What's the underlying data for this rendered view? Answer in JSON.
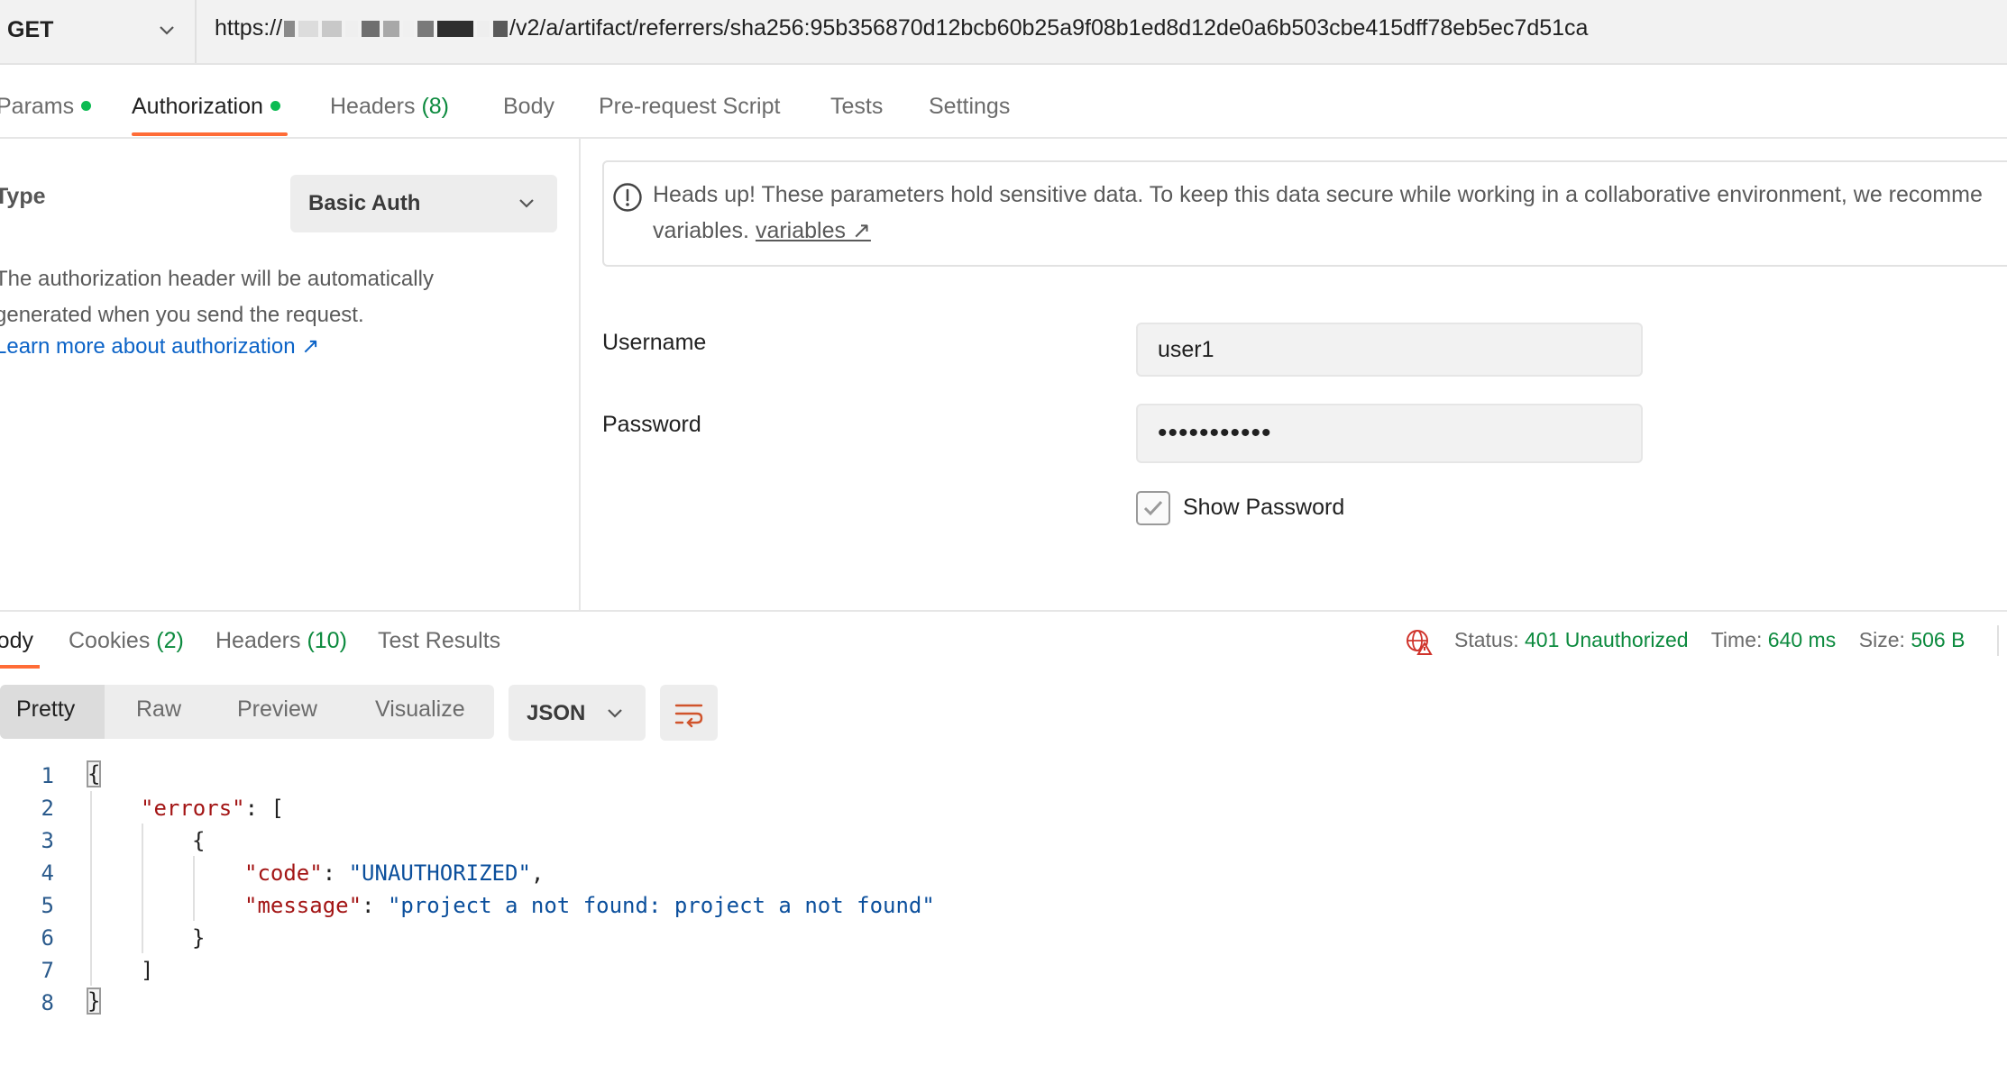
{
  "request": {
    "method": "GET",
    "url_prefix": "https://",
    "url_path": "/v2/a/artifact/referrers/sha256:95b356870d12bcb60b25a9f08b1ed8d12de0a6b503cbe415dff78eb5ec7d51ca"
  },
  "request_tabs": {
    "params": "Params",
    "authorization": "Authorization",
    "headers": "Headers",
    "headers_count": "(8)",
    "body": "Body",
    "prerequest": "Pre-request Script",
    "tests": "Tests",
    "settings": "Settings"
  },
  "auth": {
    "type_label": "Type",
    "type_value": "Basic Auth",
    "description_line1": "The authorization header will be automatically",
    "description_line2": "generated when you send the request.",
    "learn_more": "Learn more about authorization ↗",
    "headsup_line1": "Heads up! These parameters hold sensitive data. To keep this data secure while working in a collaborative environment, we recomme",
    "headsup_line2_text": "variables.",
    "headsup_link": "variables ↗",
    "username_label": "Username",
    "username_value": "user1",
    "password_label": "Password",
    "password_value": "•••••••••••",
    "show_password_label": "Show Password",
    "show_password_checked": true
  },
  "response_tabs": {
    "body": "Body",
    "cookies": "Cookies",
    "cookies_count": "(2)",
    "headers": "Headers",
    "headers_count": "(10)",
    "test_results": "Test Results"
  },
  "response_status": {
    "status_label": "Status:",
    "status_value": "401 Unauthorized",
    "time_label": "Time:",
    "time_value": "640 ms",
    "size_label": "Size:",
    "size_value": "506 B"
  },
  "view_modes": {
    "pretty": "Pretty",
    "raw": "Raw",
    "preview": "Preview",
    "visualize": "Visualize",
    "format": "JSON"
  },
  "code": {
    "line_numbers": [
      "1",
      "2",
      "3",
      "4",
      "5",
      "6",
      "7",
      "8"
    ],
    "l1": "{",
    "l2_key": "\"errors\"",
    "l2_rest": ": [",
    "l3": "{",
    "l4_key": "\"code\"",
    "l4_sep": ": ",
    "l4_val": "\"UNAUTHORIZED\"",
    "l4_end": ",",
    "l5_key": "\"message\"",
    "l5_sep": ": ",
    "l5_val": "\"project a not found: project a not found\"",
    "l6": "}",
    "l7": "]",
    "l8": "}"
  },
  "colors": {
    "accent": "#ff6c37",
    "status_green": "#0c8a3e",
    "link_blue": "#0b63c7",
    "error_red": "#d0342c"
  }
}
